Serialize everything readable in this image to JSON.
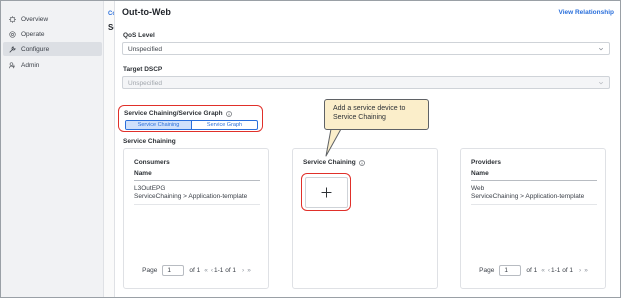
{
  "sidebar": {
    "items": [
      {
        "label": "Overview",
        "icon": "overview-icon",
        "active": false
      },
      {
        "label": "Operate",
        "icon": "operate-icon",
        "active": false
      },
      {
        "label": "Configure",
        "icon": "configure-icon",
        "active": true
      },
      {
        "label": "Admin",
        "icon": "admin-icon",
        "active": false
      }
    ]
  },
  "strip": {
    "clip_top": "Co",
    "clip_mid": "Se"
  },
  "panel": {
    "title": "Out-to-Web",
    "view_relationship": "View Relationship",
    "qos": {
      "label": "QoS Level",
      "value": "Unspecified"
    },
    "target_dscp": {
      "label": "Target DSCP",
      "value": "Unspecified"
    },
    "chaining_group": {
      "label": "Service Chaining/Service Graph",
      "options": [
        "Service Chaining",
        "Service Graph"
      ],
      "selected": "Service Chaining"
    },
    "section_label": "Service Chaining",
    "consumers": {
      "title": "Consumers",
      "column": "Name",
      "rows": [
        {
          "line1": "L3OutEPG",
          "line2": "ServiceChaining > Application-template"
        }
      ]
    },
    "service_chaining": {
      "title": "Service Chaining"
    },
    "providers": {
      "title": "Providers",
      "column": "Name",
      "rows": [
        {
          "line1": "Web",
          "line2": "ServiceChaining > Application-template"
        }
      ]
    },
    "pager": {
      "label": "Page",
      "page": "1",
      "of_label": "of",
      "total": "1",
      "range": "1-1 of 1"
    }
  },
  "callout": {
    "text_line1": "Add a service device to",
    "text_line2": "Service Chaining"
  },
  "colors": {
    "accent": "#2a6fdb",
    "highlight": "#e0302a",
    "callout_bg": "#fbeeca"
  }
}
